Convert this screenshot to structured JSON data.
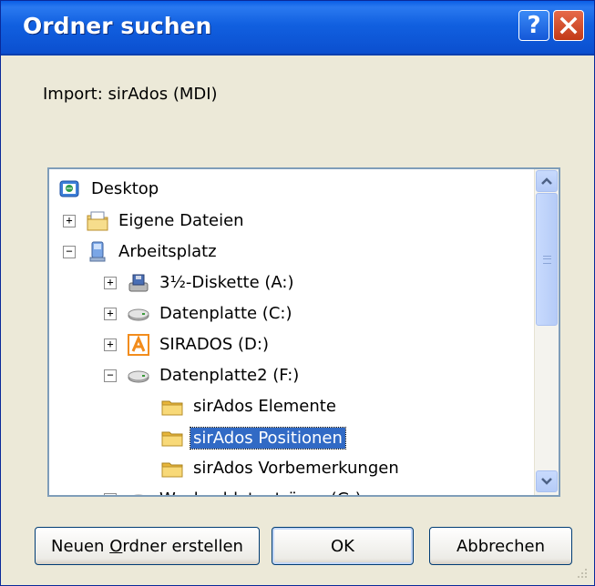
{
  "window": {
    "title": "Ordner suchen"
  },
  "titlebar": {
    "help_label": "?",
    "close_label": "✕"
  },
  "description": "Import: sirAdos (MDI)",
  "tree": {
    "items": [
      {
        "label": "Desktop",
        "icon": "desktop-icon",
        "level": 0,
        "expander": ""
      },
      {
        "label": "Eigene Dateien",
        "icon": "my-documents-icon",
        "level": 1,
        "expander": "+"
      },
      {
        "label": "Arbeitsplatz",
        "icon": "my-computer-icon",
        "level": 1,
        "expander": "−"
      },
      {
        "label": "3½-Diskette (A:)",
        "icon": "floppy-drive-icon",
        "level": 2,
        "expander": "+"
      },
      {
        "label": "Datenplatte (C:)",
        "icon": "hard-drive-icon",
        "level": 2,
        "expander": "+"
      },
      {
        "label": "SIRADOS (D:)",
        "icon": "cd-drive-icon",
        "level": 2,
        "expander": "+"
      },
      {
        "label": "Datenplatte2 (F:)",
        "icon": "hard-drive-icon",
        "level": 2,
        "expander": "−"
      },
      {
        "label": "sirAdos Elemente",
        "icon": "folder-icon",
        "level": 3,
        "expander": ""
      },
      {
        "label": "sirAdos Positionen",
        "icon": "folder-icon",
        "level": 3,
        "expander": "",
        "selected": true
      },
      {
        "label": "sirAdos Vorbemerkungen",
        "icon": "folder-icon",
        "level": 3,
        "expander": ""
      },
      {
        "label": "Wechseldatenträger (G:)",
        "icon": "removable-drive-icon",
        "level": 2,
        "expander": "+"
      }
    ]
  },
  "buttons": {
    "new_folder_pre": "Neuen ",
    "new_folder_u": "O",
    "new_folder_post": "rdner erstellen",
    "ok": "OK",
    "cancel": "Abbrechen"
  }
}
